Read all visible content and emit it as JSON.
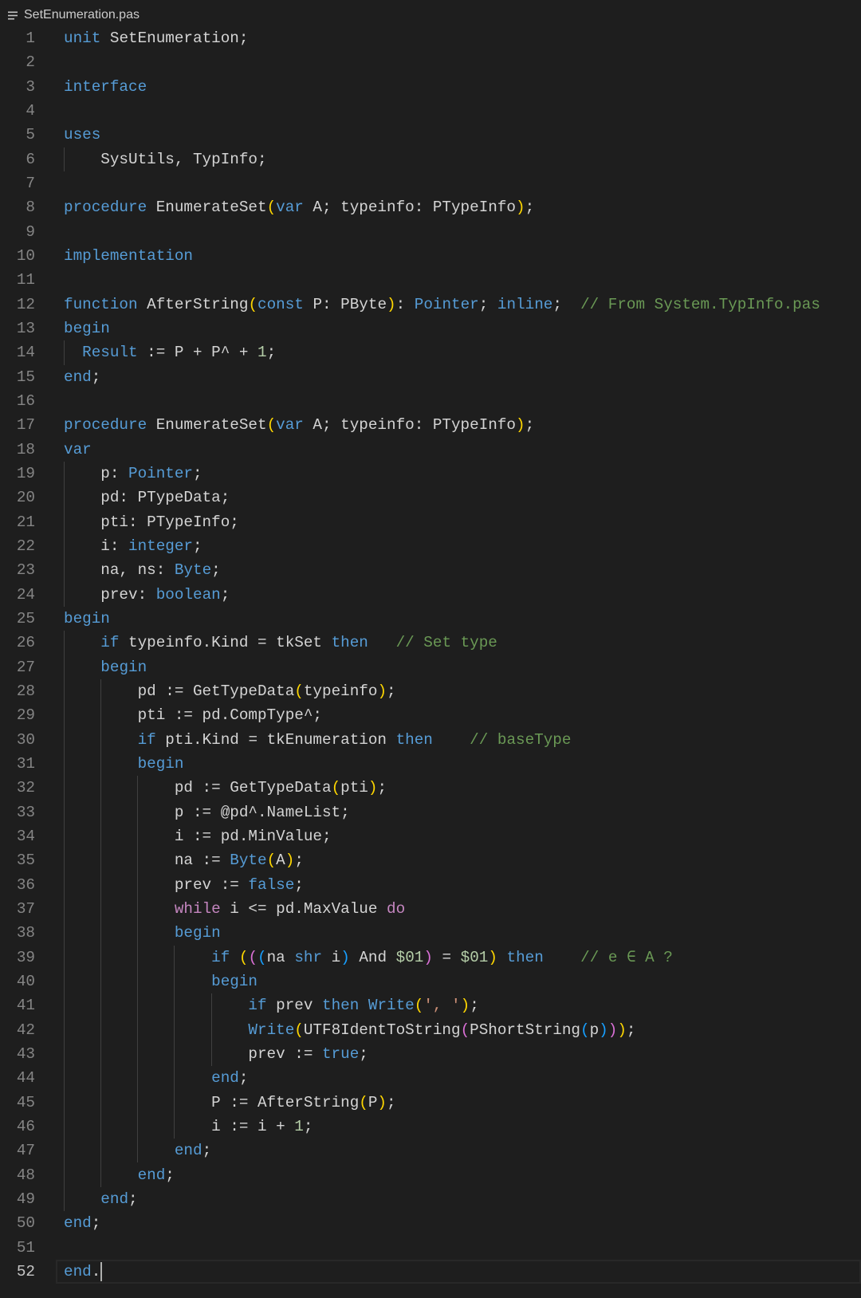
{
  "tab": {
    "icon": "lines-icon",
    "filename": "SetEnumeration.pas"
  },
  "colors": {
    "background": "#1e1e1e",
    "keyword": "#569cd6",
    "control": "#c586c0",
    "text": "#d4d4d4",
    "comment": "#6a9955",
    "number": "#b5cea8",
    "string": "#ce9178",
    "bracket1": "#ffd700",
    "bracket2": "#da70d6",
    "bracket3": "#179fff",
    "line_number": "#858585",
    "active_line_number": "#c6c6c6",
    "indent_guide": "#404040",
    "cursor": "#aeafad"
  },
  "editor": {
    "cursor": {
      "line": 52,
      "column": 5
    },
    "lines": [
      {
        "n": 1,
        "tokens": [
          [
            "unit",
            "k"
          ],
          [
            " SetEnumeration;",
            "t"
          ]
        ]
      },
      {
        "n": 2,
        "tokens": []
      },
      {
        "n": 3,
        "tokens": [
          [
            "interface",
            "k"
          ]
        ]
      },
      {
        "n": 4,
        "tokens": []
      },
      {
        "n": 5,
        "tokens": [
          [
            "uses",
            "k"
          ]
        ]
      },
      {
        "n": 6,
        "tokens": [
          [
            "    SysUtils, TypInfo;",
            "t"
          ]
        ]
      },
      {
        "n": 7,
        "tokens": []
      },
      {
        "n": 8,
        "tokens": [
          [
            "procedure",
            "k"
          ],
          [
            " EnumerateSet",
            "t"
          ],
          [
            "(",
            "b1"
          ],
          [
            "var",
            "k"
          ],
          [
            " A; typeinfo: PTypeInfo",
            "t"
          ],
          [
            ")",
            "b1"
          ],
          [
            ";",
            "t"
          ]
        ]
      },
      {
        "n": 9,
        "tokens": []
      },
      {
        "n": 10,
        "tokens": [
          [
            "implementation",
            "k"
          ]
        ]
      },
      {
        "n": 11,
        "tokens": []
      },
      {
        "n": 12,
        "tokens": [
          [
            "function",
            "k"
          ],
          [
            " AfterString",
            "t"
          ],
          [
            "(",
            "b1"
          ],
          [
            "const",
            "k"
          ],
          [
            " P: PByte",
            "t"
          ],
          [
            ")",
            "b1"
          ],
          [
            ": ",
            "t"
          ],
          [
            "Pointer",
            "k"
          ],
          [
            "; ",
            "t"
          ],
          [
            "inline",
            "k"
          ],
          [
            ";  ",
            "t"
          ],
          [
            "// From System.TypInfo.pas",
            "m"
          ]
        ]
      },
      {
        "n": 13,
        "tokens": [
          [
            "begin",
            "k"
          ]
        ]
      },
      {
        "n": 14,
        "tokens": [
          [
            "  ",
            "t"
          ],
          [
            "Result",
            "k"
          ],
          [
            " := P + P^ + ",
            "t"
          ],
          [
            "1",
            "n"
          ],
          [
            ";",
            "t"
          ]
        ]
      },
      {
        "n": 15,
        "tokens": [
          [
            "end",
            "k"
          ],
          [
            ";",
            "t"
          ]
        ]
      },
      {
        "n": 16,
        "tokens": []
      },
      {
        "n": 17,
        "tokens": [
          [
            "procedure",
            "k"
          ],
          [
            " EnumerateSet",
            "t"
          ],
          [
            "(",
            "b1"
          ],
          [
            "var",
            "k"
          ],
          [
            " A; typeinfo: PTypeInfo",
            "t"
          ],
          [
            ")",
            "b1"
          ],
          [
            ";",
            "t"
          ]
        ]
      },
      {
        "n": 18,
        "tokens": [
          [
            "var",
            "k"
          ]
        ]
      },
      {
        "n": 19,
        "tokens": [
          [
            "    p: ",
            "t"
          ],
          [
            "Pointer",
            "k"
          ],
          [
            ";",
            "t"
          ]
        ]
      },
      {
        "n": 20,
        "tokens": [
          [
            "    pd: PTypeData;",
            "t"
          ]
        ]
      },
      {
        "n": 21,
        "tokens": [
          [
            "    pti: PTypeInfo;",
            "t"
          ]
        ]
      },
      {
        "n": 22,
        "tokens": [
          [
            "    i: ",
            "t"
          ],
          [
            "integer",
            "k"
          ],
          [
            ";",
            "t"
          ]
        ]
      },
      {
        "n": 23,
        "tokens": [
          [
            "    na, ns: ",
            "t"
          ],
          [
            "Byte",
            "k"
          ],
          [
            ";",
            "t"
          ]
        ]
      },
      {
        "n": 24,
        "tokens": [
          [
            "    prev: ",
            "t"
          ],
          [
            "boolean",
            "k"
          ],
          [
            ";",
            "t"
          ]
        ]
      },
      {
        "n": 25,
        "tokens": [
          [
            "begin",
            "k"
          ]
        ]
      },
      {
        "n": 26,
        "tokens": [
          [
            "    ",
            "t"
          ],
          [
            "if",
            "k"
          ],
          [
            " typeinfo.Kind = tkSet ",
            "t"
          ],
          [
            "then",
            "k"
          ],
          [
            "   ",
            "t"
          ],
          [
            "// Set type",
            "m"
          ]
        ]
      },
      {
        "n": 27,
        "tokens": [
          [
            "    ",
            "t"
          ],
          [
            "begin",
            "k"
          ]
        ]
      },
      {
        "n": 28,
        "tokens": [
          [
            "        pd := GetTypeData",
            "t"
          ],
          [
            "(",
            "b1"
          ],
          [
            "typeinfo",
            "t"
          ],
          [
            ")",
            "b1"
          ],
          [
            ";",
            "t"
          ]
        ]
      },
      {
        "n": 29,
        "tokens": [
          [
            "        pti := pd.CompType^;",
            "t"
          ]
        ]
      },
      {
        "n": 30,
        "tokens": [
          [
            "        ",
            "t"
          ],
          [
            "if",
            "k"
          ],
          [
            " pti.Kind = tkEnumeration ",
            "t"
          ],
          [
            "then",
            "k"
          ],
          [
            "    ",
            "t"
          ],
          [
            "// baseType",
            "m"
          ]
        ]
      },
      {
        "n": 31,
        "tokens": [
          [
            "        ",
            "t"
          ],
          [
            "begin",
            "k"
          ]
        ]
      },
      {
        "n": 32,
        "tokens": [
          [
            "            pd := GetTypeData",
            "t"
          ],
          [
            "(",
            "b1"
          ],
          [
            "pti",
            "t"
          ],
          [
            ")",
            "b1"
          ],
          [
            ";",
            "t"
          ]
        ]
      },
      {
        "n": 33,
        "tokens": [
          [
            "            p := @pd^.NameList;",
            "t"
          ]
        ]
      },
      {
        "n": 34,
        "tokens": [
          [
            "            i := pd.MinValue;",
            "t"
          ]
        ]
      },
      {
        "n": 35,
        "tokens": [
          [
            "            na := ",
            "t"
          ],
          [
            "Byte",
            "k"
          ],
          [
            "(",
            "b1"
          ],
          [
            "A",
            "t"
          ],
          [
            ")",
            "b1"
          ],
          [
            ";",
            "t"
          ]
        ]
      },
      {
        "n": 36,
        "tokens": [
          [
            "            prev := ",
            "t"
          ],
          [
            "false",
            "k"
          ],
          [
            ";",
            "t"
          ]
        ]
      },
      {
        "n": 37,
        "tokens": [
          [
            "            ",
            "t"
          ],
          [
            "while",
            "c"
          ],
          [
            " i <= pd.MaxValue ",
            "t"
          ],
          [
            "do",
            "c"
          ]
        ]
      },
      {
        "n": 38,
        "tokens": [
          [
            "            ",
            "t"
          ],
          [
            "begin",
            "k"
          ]
        ]
      },
      {
        "n": 39,
        "tokens": [
          [
            "                ",
            "t"
          ],
          [
            "if",
            "k"
          ],
          [
            " ",
            "t"
          ],
          [
            "(",
            "b1"
          ],
          [
            "(",
            "b2"
          ],
          [
            "(",
            "b3"
          ],
          [
            "na ",
            "t"
          ],
          [
            "shr",
            "k"
          ],
          [
            " i",
            "t"
          ],
          [
            ")",
            "b3"
          ],
          [
            " And ",
            "t"
          ],
          [
            "$01",
            "n"
          ],
          [
            ")",
            "b2"
          ],
          [
            " = ",
            "t"
          ],
          [
            "$01",
            "n"
          ],
          [
            ")",
            "b1"
          ],
          [
            " ",
            "t"
          ],
          [
            "then",
            "k"
          ],
          [
            "    ",
            "t"
          ],
          [
            "// e ∈ A ?",
            "m"
          ]
        ]
      },
      {
        "n": 40,
        "tokens": [
          [
            "                ",
            "t"
          ],
          [
            "begin",
            "k"
          ]
        ]
      },
      {
        "n": 41,
        "tokens": [
          [
            "                    ",
            "t"
          ],
          [
            "if",
            "k"
          ],
          [
            " prev ",
            "t"
          ],
          [
            "then",
            "k"
          ],
          [
            " ",
            "t"
          ],
          [
            "Write",
            "k"
          ],
          [
            "(",
            "b1"
          ],
          [
            "', '",
            "s"
          ],
          [
            ")",
            "b1"
          ],
          [
            ";",
            "t"
          ]
        ]
      },
      {
        "n": 42,
        "tokens": [
          [
            "                    ",
            "t"
          ],
          [
            "Write",
            "k"
          ],
          [
            "(",
            "b1"
          ],
          [
            "UTF8IdentToString",
            "t"
          ],
          [
            "(",
            "b2"
          ],
          [
            "PShortString",
            "t"
          ],
          [
            "(",
            "b3"
          ],
          [
            "p",
            "t"
          ],
          [
            ")",
            "b3"
          ],
          [
            ")",
            "b2"
          ],
          [
            ")",
            "b1"
          ],
          [
            ";",
            "t"
          ]
        ]
      },
      {
        "n": 43,
        "tokens": [
          [
            "                    prev := ",
            "t"
          ],
          [
            "true",
            "k"
          ],
          [
            ";",
            "t"
          ]
        ]
      },
      {
        "n": 44,
        "tokens": [
          [
            "                ",
            "t"
          ],
          [
            "end",
            "k"
          ],
          [
            ";",
            "t"
          ]
        ]
      },
      {
        "n": 45,
        "tokens": [
          [
            "                P := AfterString",
            "t"
          ],
          [
            "(",
            "b1"
          ],
          [
            "P",
            "t"
          ],
          [
            ")",
            "b1"
          ],
          [
            ";",
            "t"
          ]
        ]
      },
      {
        "n": 46,
        "tokens": [
          [
            "                i := i + ",
            "t"
          ],
          [
            "1",
            "n"
          ],
          [
            ";",
            "t"
          ]
        ]
      },
      {
        "n": 47,
        "tokens": [
          [
            "            ",
            "t"
          ],
          [
            "end",
            "k"
          ],
          [
            ";",
            "t"
          ]
        ]
      },
      {
        "n": 48,
        "tokens": [
          [
            "        ",
            "t"
          ],
          [
            "end",
            "k"
          ],
          [
            ";",
            "t"
          ]
        ]
      },
      {
        "n": 49,
        "tokens": [
          [
            "    ",
            "t"
          ],
          [
            "end",
            "k"
          ],
          [
            ";",
            "t"
          ]
        ]
      },
      {
        "n": 50,
        "tokens": [
          [
            "end",
            "k"
          ],
          [
            ";",
            "t"
          ]
        ]
      },
      {
        "n": 51,
        "tokens": []
      },
      {
        "n": 52,
        "tokens": [
          [
            "end",
            "k"
          ],
          [
            ".",
            "t"
          ]
        ]
      }
    ]
  }
}
